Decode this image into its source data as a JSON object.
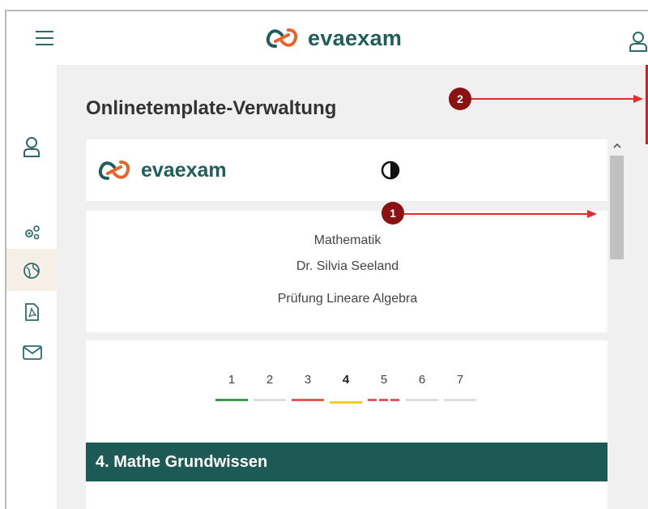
{
  "app": {
    "brand_name": "evaexam",
    "accent_color": "#1e5a55",
    "logo_orange": "#e8622c"
  },
  "header": {
    "menu_icon": "hamburger-icon",
    "user_icon": "user-icon"
  },
  "sidebar": {
    "items": [
      {
        "icon": "user-icon"
      },
      {
        "icon": "settings-icon"
      },
      {
        "icon": "globe-icon",
        "active": true
      },
      {
        "icon": "pdf-icon"
      },
      {
        "icon": "mail-icon"
      }
    ]
  },
  "page": {
    "title": "Onlinetemplate-Verwaltung"
  },
  "preview": {
    "brand_name": "evaexam",
    "contrast_icon": "contrast-icon",
    "subject": "Mathematik",
    "lecturer": "Dr. Silvia Seeland",
    "exam_name": "Prüfung Lineare Algebra",
    "steps": [
      {
        "label": "1",
        "status_color": "#3a9a4a",
        "style": "solid"
      },
      {
        "label": "2",
        "status_color": "#dddddd",
        "style": "solid"
      },
      {
        "label": "3",
        "status_color": "#e05a5a",
        "style": "solid"
      },
      {
        "label": "4",
        "status_color": "#f2cf24",
        "style": "solid",
        "active": true
      },
      {
        "label": "5",
        "status_color": "#e05a5a",
        "style": "dashed"
      },
      {
        "label": "6",
        "status_color": "#dddddd",
        "style": "solid"
      },
      {
        "label": "7",
        "status_color": "#dddddd",
        "style": "solid"
      }
    ],
    "section_title": "4. Mathe Grundwissen"
  },
  "annotations": [
    {
      "label": "1"
    },
    {
      "label": "2"
    }
  ]
}
